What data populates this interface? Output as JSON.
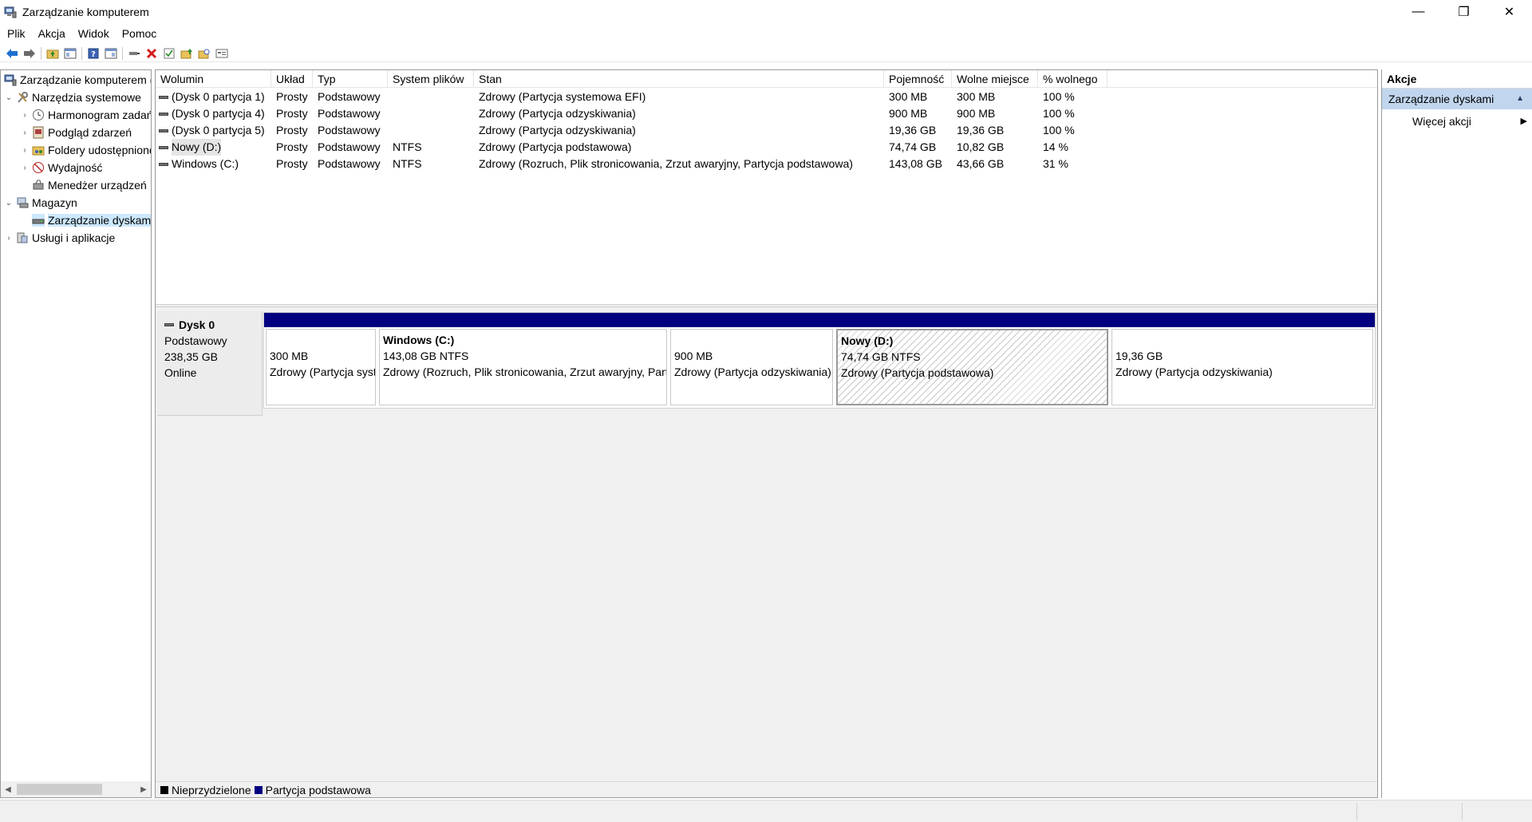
{
  "window": {
    "title": "Zarządzanie komputerem",
    "minimize_glyph": "—",
    "restore_glyph": "❐",
    "close_glyph": "✕"
  },
  "menu": [
    "Plik",
    "Akcja",
    "Widok",
    "Pomoc"
  ],
  "toolbar": {
    "icons": [
      "back-icon",
      "forward-icon",
      "up-folder-icon",
      "show-hide-tree-icon",
      "help-icon",
      "properties-icon",
      "connect-icon",
      "delete-icon",
      "check-icon",
      "folder-up-icon",
      "folder-search-icon",
      "console-icon"
    ]
  },
  "tree": {
    "items": [
      {
        "label": "Zarządzanie komputerem (lokalne)",
        "level": 0,
        "expander": "",
        "icon": "computer-management-icon"
      },
      {
        "label": "Narzędzia systemowe",
        "level": 0,
        "expander": "⌄",
        "icon": "tools-icon"
      },
      {
        "label": "Harmonogram zadań",
        "level": 1,
        "expander": "›",
        "icon": "clock-icon"
      },
      {
        "label": "Podgląd zdarzeń",
        "level": 1,
        "expander": "›",
        "icon": "event-viewer-icon"
      },
      {
        "label": "Foldery udostępnione",
        "level": 1,
        "expander": "›",
        "icon": "shared-folder-icon"
      },
      {
        "label": "Wydajność",
        "level": 1,
        "expander": "›",
        "icon": "performance-icon"
      },
      {
        "label": "Menedżer urządzeń",
        "level": 1,
        "expander": "",
        "icon": "device-manager-icon"
      },
      {
        "label": "Magazyn",
        "level": 0,
        "expander": "⌄",
        "icon": "storage-icon"
      },
      {
        "label": "Zarządzanie dyskami",
        "level": 1,
        "expander": "",
        "icon": "disk-management-icon",
        "selected": true
      },
      {
        "label": "Usługi i aplikacje",
        "level": 0,
        "expander": "›",
        "icon": "services-icon"
      }
    ]
  },
  "volumes": {
    "columns": [
      "Wolumin",
      "Układ",
      "Typ",
      "System plików",
      "Stan",
      "Pojemność",
      "Wolne miejsce",
      "% wolnego"
    ],
    "rows": [
      [
        "(Dysk 0 partycja 1)",
        "Prosty",
        "Podstawowy",
        "",
        "Zdrowy (Partycja systemowa EFI)",
        "300 MB",
        "300 MB",
        "100 %"
      ],
      [
        "(Dysk 0 partycja 4)",
        "Prosty",
        "Podstawowy",
        "",
        "Zdrowy (Partycja odzyskiwania)",
        "900 MB",
        "900 MB",
        "100 %"
      ],
      [
        "(Dysk 0 partycja 5)",
        "Prosty",
        "Podstawowy",
        "",
        "Zdrowy (Partycja odzyskiwania)",
        "19,36 GB",
        "19,36 GB",
        "100 %"
      ],
      [
        "Nowy (D:)",
        "Prosty",
        "Podstawowy",
        "NTFS",
        "Zdrowy (Partycja podstawowa)",
        "74,74 GB",
        "10,82 GB",
        "14 %"
      ],
      [
        "Windows (C:)",
        "Prosty",
        "Podstawowy",
        "NTFS",
        "Zdrowy (Rozruch, Plik stronicowania, Zrzut awaryjny, Partycja podstawowa)",
        "143,08 GB",
        "43,66 GB",
        "31 %"
      ]
    ]
  },
  "disk": {
    "name": "Dysk 0",
    "type": "Podstawowy",
    "size": "238,35 GB",
    "status": "Online",
    "partitions": [
      {
        "name": "",
        "size": "300 MB",
        "state": "Zdrowy (Partycja systemowa EFI)"
      },
      {
        "name": "Windows  (C:)",
        "size": "143,08 GB NTFS",
        "state": "Zdrowy (Rozruch, Plik stronicowania, Zrzut awaryjny, Partycja podstawowa)"
      },
      {
        "name": "",
        "size": "900 MB",
        "state": "Zdrowy (Partycja odzyskiwania)"
      },
      {
        "name": "Nowy  (D:)",
        "size": "74,74 GB NTFS",
        "state": "Zdrowy (Partycja podstawowa)",
        "selected": true
      },
      {
        "name": "",
        "size": "19,36 GB",
        "state": "Zdrowy (Partycja odzyskiwania)"
      }
    ]
  },
  "legend": [
    {
      "label": "Nieprzydzielone",
      "color": "#000000"
    },
    {
      "label": "Partycja podstawowa",
      "color": "#000080"
    }
  ],
  "actions": {
    "header": "Akcje",
    "group": "Zarządzanie dyskami",
    "items": [
      "Więcej akcji"
    ]
  },
  "colors": {
    "partition_bar": "#000080",
    "selected_tree": "#cce8ff",
    "actions_group": "#c1d6ee"
  }
}
